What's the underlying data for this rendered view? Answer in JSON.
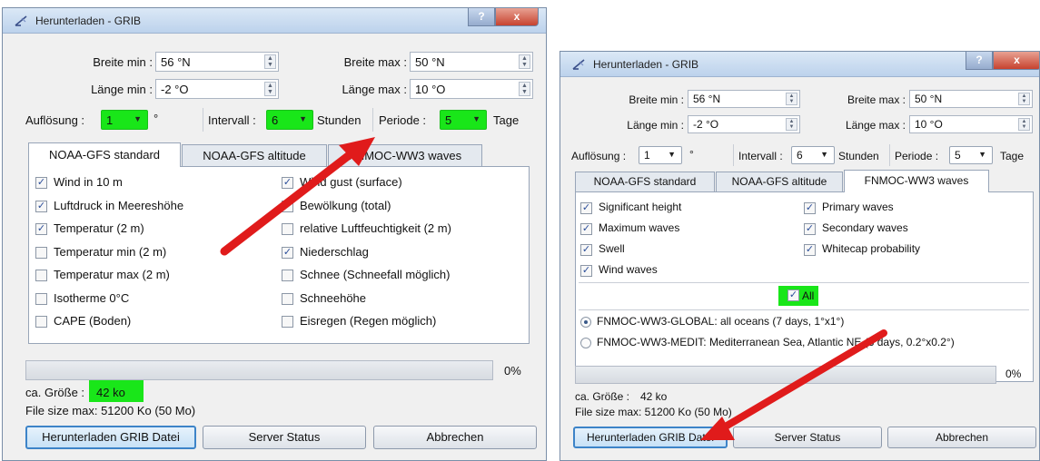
{
  "left": {
    "title": "Herunterladen - GRIB",
    "help": "?",
    "close": "x",
    "lat_min_label": "Breite min :",
    "lat_min_value": "56 °N",
    "lat_max_label": "Breite max :",
    "lat_max_value": "50 °N",
    "lon_min_label": "Länge min :",
    "lon_min_value": "-2 °O",
    "lon_max_label": "Länge max :",
    "lon_max_value": "10 °O",
    "resolution_label": "Auflösung :",
    "resolution_value": "1",
    "resolution_unit": "°",
    "interval_label": "Intervall :",
    "interval_value": "6",
    "interval_unit": "Stunden",
    "period_label": "Periode :",
    "period_value": "5",
    "period_unit": "Tage",
    "tabs": [
      "NOAA-GFS standard",
      "NOAA-GFS altitude",
      "FNMOC-WW3 waves"
    ],
    "options_left": [
      {
        "label": "Wind in 10 m",
        "checked": true
      },
      {
        "label": "Luftdruck in Meereshöhe",
        "checked": true
      },
      {
        "label": "Temperatur (2 m)",
        "checked": true
      },
      {
        "label": "Temperatur min  (2 m)",
        "checked": false
      },
      {
        "label": "Temperatur max (2 m)",
        "checked": false
      },
      {
        "label": "Isotherme 0°C",
        "checked": false
      },
      {
        "label": "CAPE (Boden)",
        "checked": false
      }
    ],
    "options_right": [
      {
        "label": "Wind gust (surface)",
        "checked": true
      },
      {
        "label": "Bewölkung (total)",
        "checked": false
      },
      {
        "label": "relative Luftfeuchtigkeit (2 m)",
        "checked": false
      },
      {
        "label": "Niederschlag",
        "checked": true
      },
      {
        "label": "Schnee (Schneefall möglich)",
        "checked": false
      },
      {
        "label": "Schneehöhe",
        "checked": false
      },
      {
        "label": "Eisregen (Regen möglich)",
        "checked": false
      }
    ],
    "progress_percent": 0,
    "progress_text": "0%",
    "size_label": "ca. Größe :",
    "size_value": "42 ko",
    "max_size": "File size max: 51200 Ko (50 Mo)",
    "btn_download": "Herunterladen GRIB Datei",
    "btn_status": "Server Status",
    "btn_cancel": "Abbrechen"
  },
  "right": {
    "title": "Herunterladen - GRIB",
    "help": "?",
    "close": "x",
    "lat_min_label": "Breite min :",
    "lat_min_value": "56 °N",
    "lat_max_label": "Breite max :",
    "lat_max_value": "50 °N",
    "lon_min_label": "Länge min :",
    "lon_min_value": "-2 °O",
    "lon_max_label": "Länge max :",
    "lon_max_value": "10 °O",
    "resolution_label": "Auflösung :",
    "resolution_value": "1",
    "resolution_unit": "°",
    "interval_label": "Intervall :",
    "interval_value": "6",
    "interval_unit": "Stunden",
    "period_label": "Periode :",
    "period_value": "5",
    "period_unit": "Tage",
    "tabs": [
      "NOAA-GFS standard",
      "NOAA-GFS altitude",
      "FNMOC-WW3 waves"
    ],
    "waves_left": [
      {
        "label": "Significant height",
        "checked": true
      },
      {
        "label": "Maximum waves",
        "checked": true
      },
      {
        "label": "Swell",
        "checked": true
      },
      {
        "label": "Wind waves",
        "checked": true
      }
    ],
    "waves_right": [
      {
        "label": "Primary waves",
        "checked": true
      },
      {
        "label": "Secondary waves",
        "checked": true
      },
      {
        "label": "Whitecap probability",
        "checked": true
      }
    ],
    "all_label": "All",
    "models": [
      {
        "label": "FNMOC-WW3-GLOBAL: all oceans (7 days, 1°x1°)",
        "selected": true
      },
      {
        "label": "FNMOC-WW3-MEDIT: Mediterranean Sea, Atlantic NE (3 days, 0.2°x0.2°)",
        "selected": false
      }
    ],
    "progress_percent": 0,
    "progress_text": "0%",
    "size_label": "ca. Größe :",
    "size_value": "42 ko",
    "max_size": "File size max: 51200 Ko (50 Mo)",
    "btn_download": "Herunterladen GRIB Datei",
    "btn_status": "Server Status",
    "btn_cancel": "Abbrechen"
  },
  "colors": {
    "highlight": "#19e619",
    "arrow": "#e01b1b",
    "default_button": "#3d84c8"
  },
  "icons": [
    "grib-app-icon",
    "help-icon",
    "close-icon",
    "spin-arrows-icon",
    "dropdown-caret-icon",
    "checkmark-icon"
  ]
}
